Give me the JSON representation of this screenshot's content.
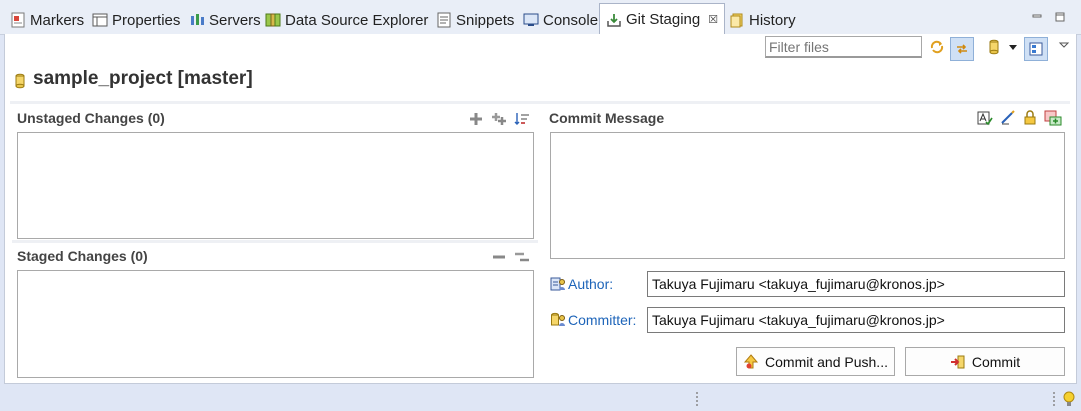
{
  "tabs": [
    {
      "label": "Markers",
      "icon": "markers-icon"
    },
    {
      "label": "Properties",
      "icon": "properties-icon"
    },
    {
      "label": "Servers",
      "icon": "servers-icon"
    },
    {
      "label": "Data Source Explorer",
      "icon": "data-source-icon"
    },
    {
      "label": "Snippets",
      "icon": "snippets-icon"
    },
    {
      "label": "Console",
      "icon": "console-icon"
    },
    {
      "label": "Git Staging",
      "icon": "git-staging-icon",
      "active": true,
      "close": "☒"
    },
    {
      "label": "History",
      "icon": "history-icon"
    }
  ],
  "toolbar": {
    "filter_placeholder": "Filter files"
  },
  "repo": {
    "title": "sample_project [master]"
  },
  "unstaged": {
    "title": "Unstaged Changes (0)"
  },
  "staged": {
    "title": "Staged Changes (0)"
  },
  "commit": {
    "title": "Commit Message",
    "author_label": "Author:",
    "author_value": "Takuya Fujimaru <takuya_fujimaru@kronos.jp>",
    "committer_label": "Committer:",
    "committer_value": "Takuya Fujimaru <takuya_fujimaru@kronos.jp>",
    "commit_push_label": "Commit and Push...",
    "commit_label": "Commit"
  },
  "colors": {
    "accent_blue": "#1d64b9",
    "tab_bg": "#e9eef7",
    "frame_bg": "#dfe6f5"
  }
}
